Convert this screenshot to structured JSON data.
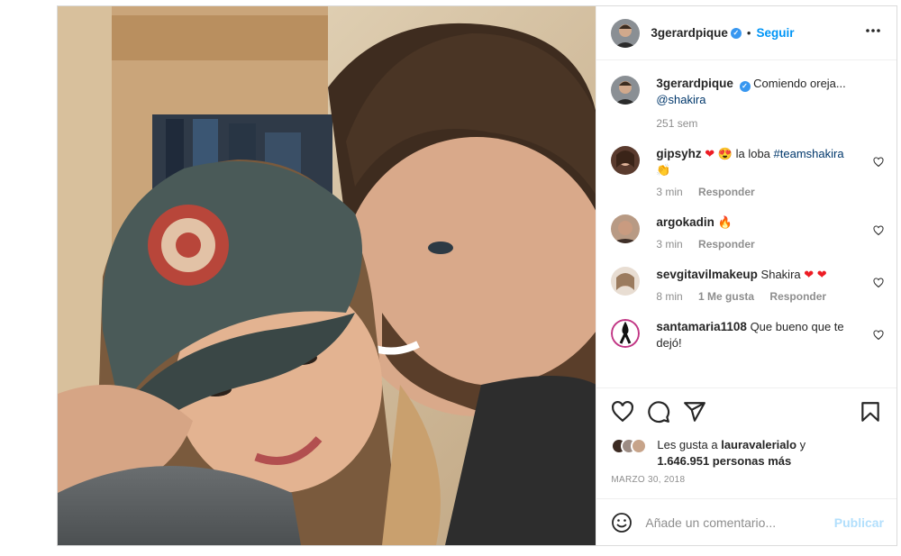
{
  "post": {
    "author": "3gerardpique",
    "follow_label": "Seguir",
    "dot": "•",
    "verified_mark": "✓"
  },
  "caption": {
    "author": "3gerardpique",
    "text": "Comiendo oreja...",
    "mention": "@shakira",
    "time": "251 sem"
  },
  "comments": [
    {
      "user": "gipsyhz",
      "emoji_a": "❤",
      "emoji_b": "😍",
      "text": "la loba",
      "tag": "#teamshakira",
      "emoji_c": "👏",
      "time": "3 min",
      "reply": "Responder"
    },
    {
      "user": "argokadin",
      "emoji_a": "🔥",
      "time": "3 min",
      "reply": "Responder"
    },
    {
      "user": "sevgitavilmakeup",
      "text": "Shakira",
      "emoji_a": "❤",
      "emoji_b": "❤",
      "time": "8 min",
      "likes": "1 Me gusta",
      "reply": "Responder"
    },
    {
      "user": "santamaria1108",
      "text": "Que bueno que te dejó!"
    }
  ],
  "likes": {
    "prefix": "Les gusta a",
    "user": "lauravalerialo",
    "conj": "y",
    "count": "1.646.951 personas más"
  },
  "date": "MARZO 30, 2018",
  "add_comment": {
    "placeholder": "Añade un comentario...",
    "publish": "Publicar"
  },
  "icons": [
    "more-icon",
    "heart-icon",
    "comment-icon",
    "share-icon",
    "save-icon",
    "emoji-icon",
    "verified-icon"
  ],
  "colors": {
    "accent": "#0095f6",
    "publish_disabled": "#b2dffc",
    "meta": "#8e8e8e",
    "link": "#00376b",
    "heart_red": "#ed1c24"
  }
}
